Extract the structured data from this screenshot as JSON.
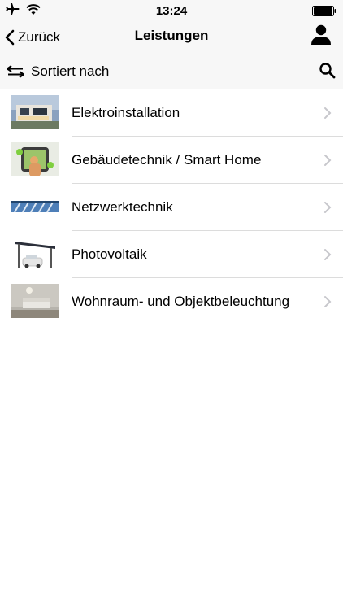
{
  "status_bar": {
    "time": "13:24",
    "icons": [
      "airplane-icon",
      "wifi-icon",
      "battery-icon"
    ]
  },
  "nav": {
    "back_label": "Zurück",
    "title": "Leistungen",
    "user_icon": "user-icon"
  },
  "sort_bar": {
    "label": "Sortiert nach",
    "sort_icon": "swap-arrows-icon",
    "search_icon": "search-icon"
  },
  "items": [
    {
      "label": "Elektroinstallation",
      "thumb": "modern-house-photo"
    },
    {
      "label": "Gebäudetechnik / Smart Home",
      "thumb": "smartphone-hand-photo"
    },
    {
      "label": "Netzwerktechnik",
      "thumb": "network-cables-photo"
    },
    {
      "label": "Photovoltaik",
      "thumb": "solar-carport-photo"
    },
    {
      "label": "Wohnraum- und Objektbeleuchtung",
      "thumb": "living-room-photo"
    }
  ],
  "colors": {
    "bar_background": "#f7f7f7",
    "separator": "#dcdcdc",
    "chevron": "#c7c7cc"
  }
}
